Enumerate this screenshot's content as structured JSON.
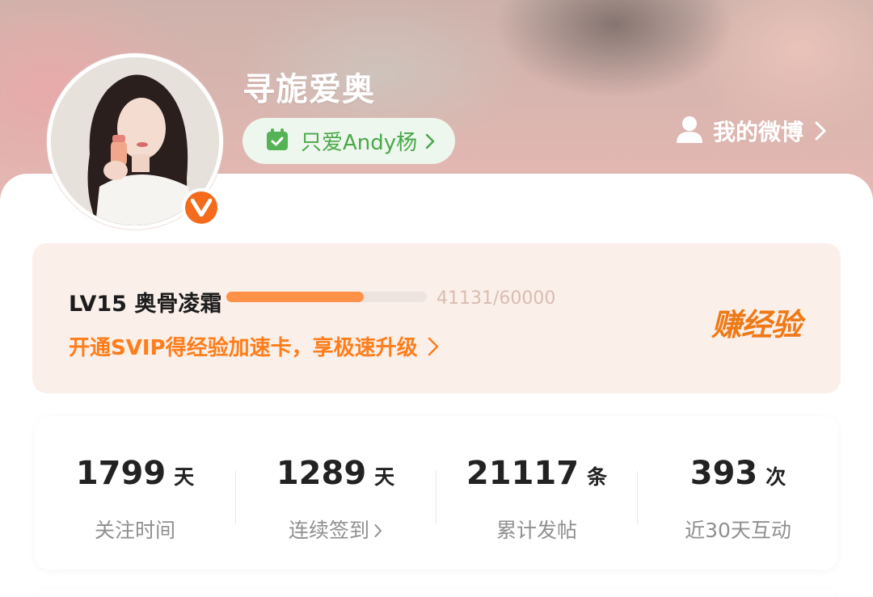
{
  "profile": {
    "username": "寻旎爱奥",
    "group_chip_label": "只爱Andy杨",
    "my_weibo_label": "我的微博",
    "vip_badge_letter": "V"
  },
  "level": {
    "title": "LV15 奥骨凌霜",
    "progress_text": "41131/60000",
    "progress_fraction": 0.6855,
    "svip_link_label": "开通SVIP得经验加速卡，享极速升级",
    "earn_exp_label": "赚经验"
  },
  "stats": [
    {
      "number": "1799",
      "unit": "天",
      "label": "关注时间",
      "has_chevron": false
    },
    {
      "number": "1289",
      "unit": "天",
      "label": "连续签到",
      "has_chevron": true
    },
    {
      "number": "21117",
      "unit": "条",
      "label": "累计发帖",
      "has_chevron": false
    },
    {
      "number": "393",
      "unit": "次",
      "label": "近30天互动",
      "has_chevron": false
    }
  ],
  "colors": {
    "accent_orange": "#ff7d1a",
    "progress_fill": "#ff9248",
    "chip_green": "#4aa84a",
    "vip_badge": "#f46b1b"
  },
  "icons": {
    "chip_icon": "calendar-check-icon",
    "my_weibo_icon": "user-icon",
    "chevron": "chevron-right-icon"
  }
}
